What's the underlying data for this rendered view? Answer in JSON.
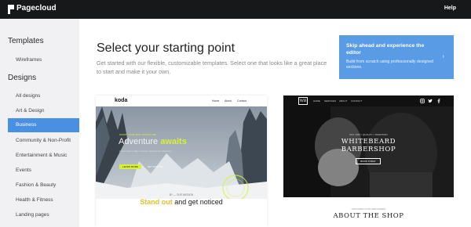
{
  "topbar": {
    "brand": "Pagecloud",
    "help": "Help"
  },
  "sidebar": {
    "templates_heading": "Templates",
    "wireframes": "Wireframes",
    "designs_heading": "Designs",
    "items": [
      {
        "label": "All designs"
      },
      {
        "label": "Art & Design"
      },
      {
        "label": "Business",
        "active": true
      },
      {
        "label": "Community & Non-Profit"
      },
      {
        "label": "Entertainment & Music"
      },
      {
        "label": "Events"
      },
      {
        "label": "Fashion & Beauty"
      },
      {
        "label": "Health & Fitness"
      },
      {
        "label": "Landing pages"
      }
    ]
  },
  "main": {
    "title": "Select your starting point",
    "description": "Get started with our flexible, customizable templates. Select one that looks like a great place to start and make it your own."
  },
  "skip": {
    "title": "Skip ahead and experience the editor",
    "subtitle": "Build from scratch using professionally designed sections.",
    "arrow": "›"
  },
  "templates": {
    "koda": {
      "brand": "koda",
      "nav": [
        "Home",
        "About",
        "Contact"
      ],
      "small": "START YOUR NEXT ADVENTURE",
      "headline_1": "Adventure ",
      "headline_2": "awaits",
      "sub": "Lorem ipsum dolor sit amet consectetur adipiscing",
      "btn1": "LEARN MORE",
      "btn2": "GET STARTED →",
      "label": "BY — OUR MISSION",
      "bottom_1": "Stand out",
      "bottom_2": " and get noticed"
    },
    "whitebeard": {
      "logo": "WB",
      "nav": [
        "HOME",
        "SERVICES",
        "ABOUT",
        "CONTACT"
      ],
      "small": "EST. 1967 • QUALITY • TRADITION",
      "title_1": "WHITEBEARD",
      "title_2": "BARBERSHOP",
      "btn": "BOOK TODAY",
      "label": "GROOMING FOR GENTLEMEN",
      "about": "ABOUT THE SHOP"
    }
  }
}
